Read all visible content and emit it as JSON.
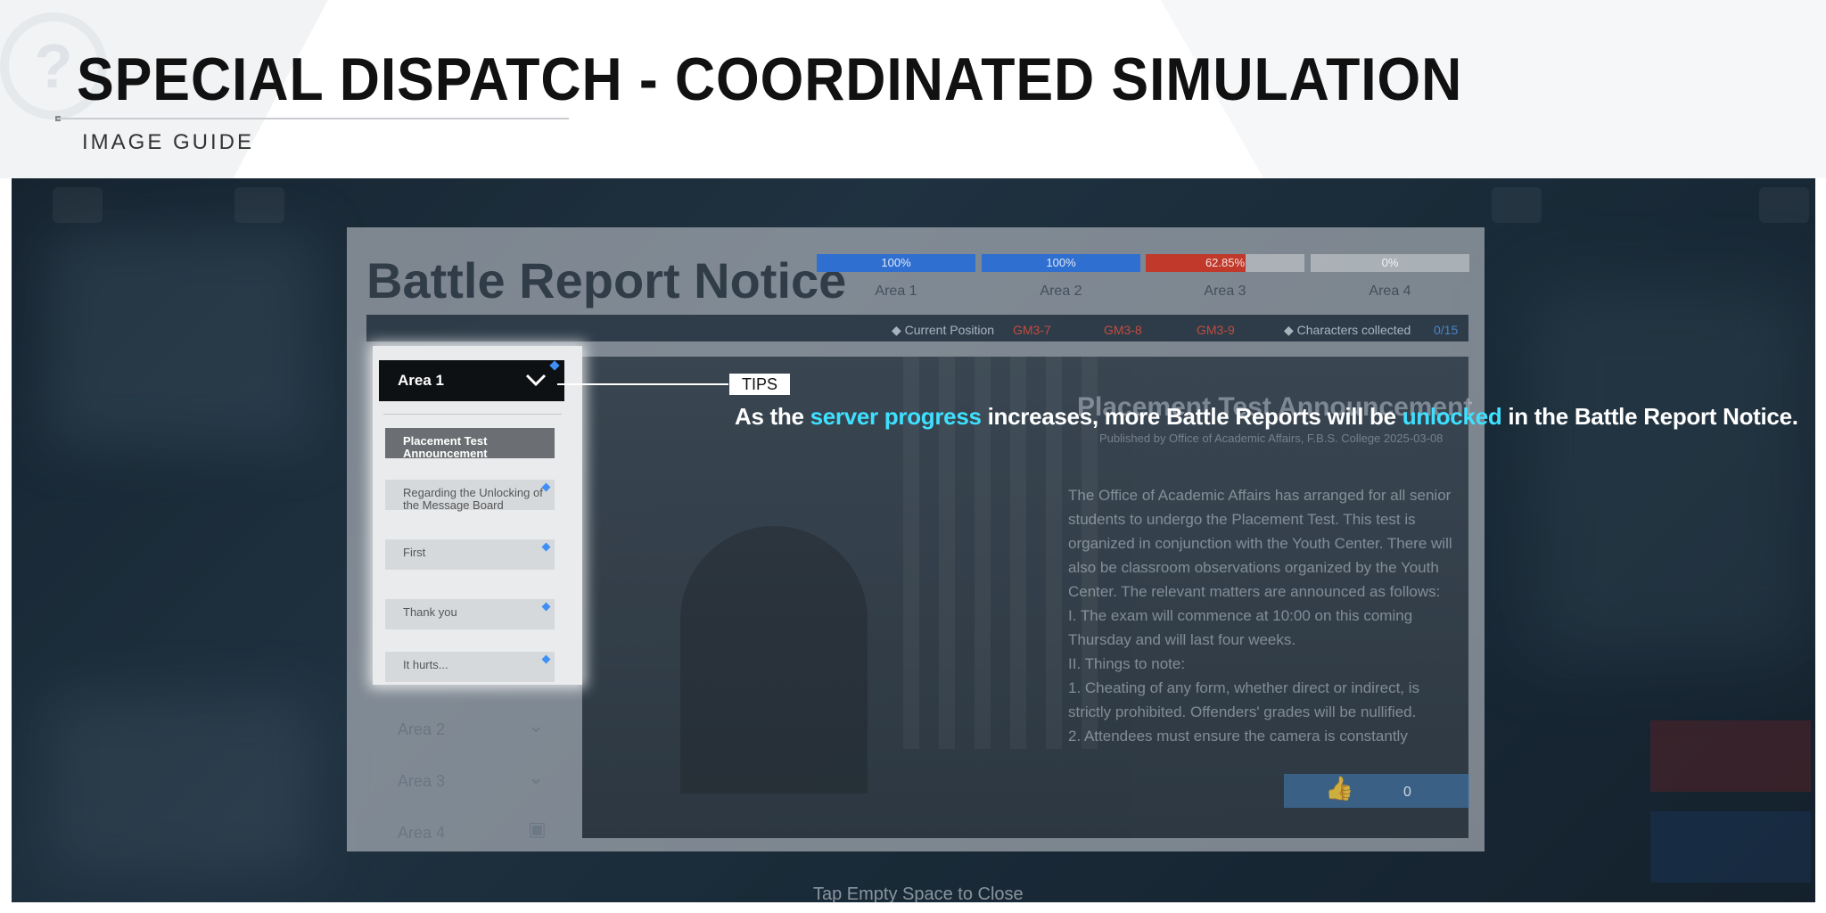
{
  "header": {
    "title": "SPECIAL DISPATCH - COORDINATED SIMULATION",
    "subtitle": "IMAGE GUIDE"
  },
  "dialog": {
    "title": "Battle Report Notice",
    "areas": [
      {
        "label": "Area 1",
        "progress": "100%",
        "progress_value": 100,
        "color": "#2f6fd0"
      },
      {
        "label": "Area 2",
        "progress": "100%",
        "progress_value": 100,
        "color": "#2f6fd0"
      },
      {
        "label": "Area 3",
        "progress": "62.85%",
        "progress_value": 62.85,
        "color": "#c0392b"
      },
      {
        "label": "Area 4",
        "progress": "0%",
        "progress_value": 0,
        "color": "#2f6fd0"
      }
    ],
    "status": {
      "current_position_label": "Current Position",
      "positions": [
        "GM3-7",
        "GM3-8",
        "GM3-9"
      ],
      "characters_label": "Characters collected",
      "characters_value": "0/15"
    },
    "sidebar": {
      "area1_label": "Area 1",
      "items": [
        {
          "label": "Placement Test Announcement"
        },
        {
          "label": "Regarding the Unlocking of the Message Board"
        },
        {
          "label": "First"
        },
        {
          "label": "Thank you"
        },
        {
          "label": "It hurts..."
        }
      ],
      "other_areas": [
        "Area 2",
        "Area 3",
        "Area 4"
      ]
    },
    "article": {
      "title": "Placement Test Announcement",
      "meta": "Published by Office of Academic Affairs, F.B.S. College   2025-03-08",
      "body": "The Office of Academic Affairs has arranged for all senior students to undergo the Placement Test. This test is organized in conjunction with the Youth Center. There will also be classroom observations organized by the Youth Center. The relevant matters are announced as follows:\nI. The exam will commence at 10:00 on this coming Thursday and will last four weeks.\nII. Things to note:\n1. Cheating of any form, whether direct or indirect, is strictly prohibited. Offenders' grades will be nullified.\n2. Attendees must ensure the camera is constantly",
      "likes": "0"
    },
    "close_hint": "Tap Empty Space to Close"
  },
  "tip": {
    "label": "TIPS",
    "text_1": "As the ",
    "highlight_1": "server progress",
    "text_2": " increases, more Battle Reports will be ",
    "highlight_2": "unlocked",
    "text_3": " in the Battle Report Notice."
  },
  "colors": {
    "highlight": "#3fe0ff",
    "accent_blue": "#3f8ff5"
  }
}
